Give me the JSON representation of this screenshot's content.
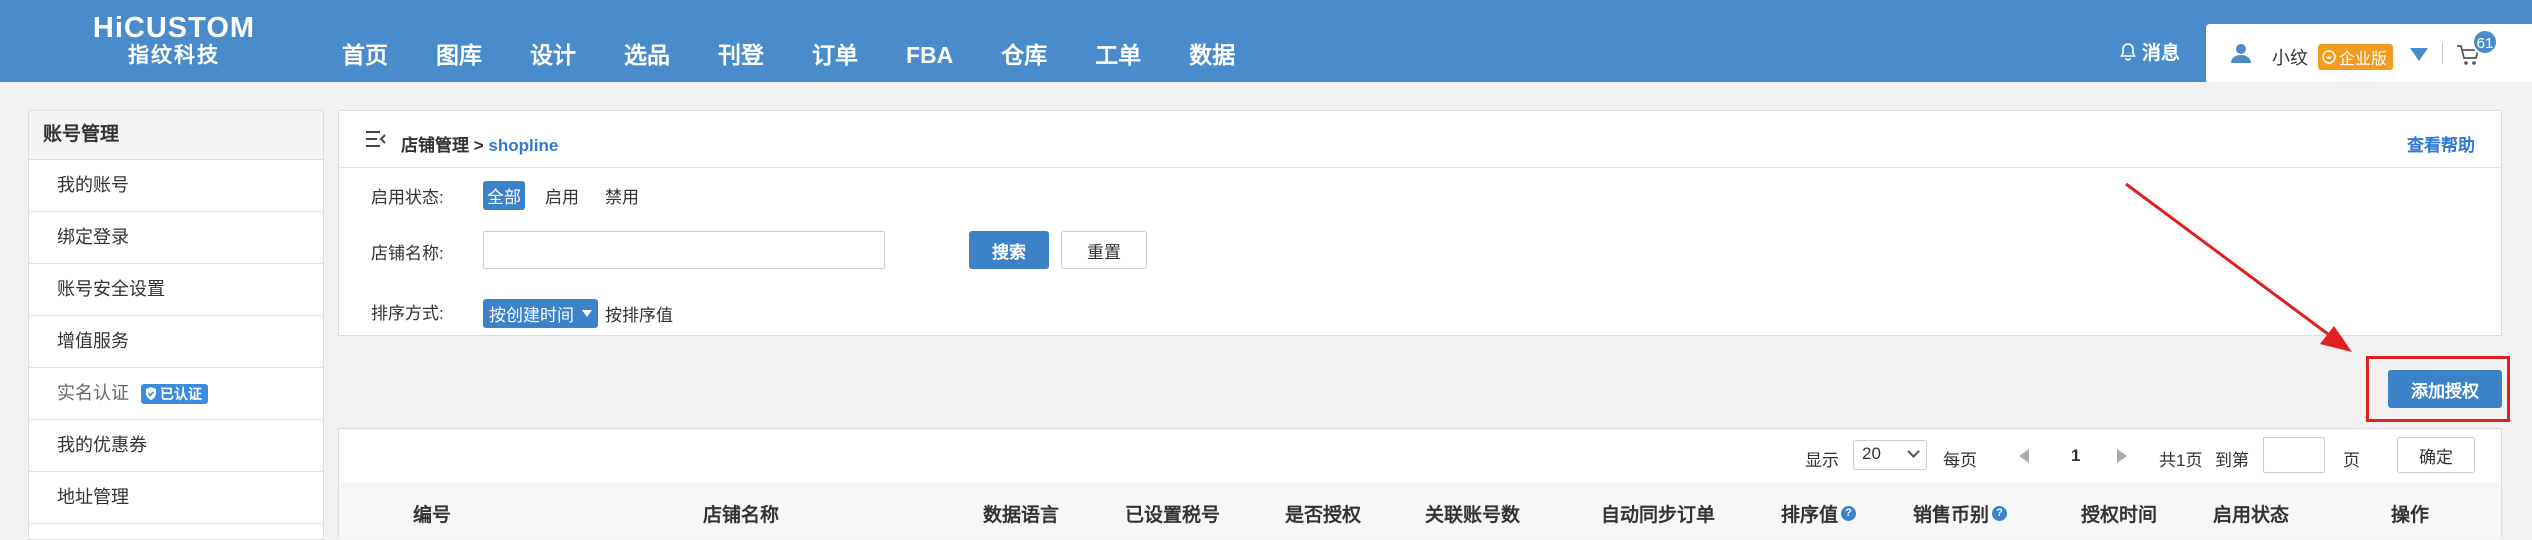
{
  "brand": {
    "line1": "HiCUSTOM",
    "line2": "指纹科技"
  },
  "nav": [
    "首页",
    "图库",
    "设计",
    "选品",
    "刊登",
    "订单",
    "FBA",
    "仓库",
    "工单",
    "数据"
  ],
  "header": {
    "messages": "消息",
    "username": "小纹",
    "edition": "企业版",
    "cart_count": "61"
  },
  "sidebar": {
    "title": "账号管理",
    "items": [
      "我的账号",
      "绑定登录",
      "账号安全设置",
      "增值服务",
      "实名认证",
      "我的优惠券",
      "地址管理"
    ],
    "verified_badge": "已认证"
  },
  "breadcrumb": {
    "parent": "店铺管理",
    "sep": ">",
    "current": "shopline"
  },
  "help_link": "查看帮助",
  "filters": {
    "status_label": "启用状态:",
    "status_options": [
      "全部",
      "启用",
      "禁用"
    ],
    "name_label": "店铺名称:",
    "name_value": "",
    "search_btn": "搜索",
    "reset_btn": "重置",
    "sort_label": "排序方式:",
    "sort_selected": "按创建时间",
    "sort_alt": "按排序值"
  },
  "add_button": "添加授权",
  "pager": {
    "show_label": "显示",
    "page_size": "20",
    "per_page_label": "每页",
    "current_page": "1",
    "total_pages": "共1页",
    "goto_label": "到第",
    "page_unit": "页",
    "confirm_btn": "确定"
  },
  "table": {
    "headers": [
      "编号",
      "店铺名称",
      "数据语言",
      "已设置税号",
      "是否授权",
      "关联账号数",
      "自动同步订单",
      "排序值",
      "销售币别",
      "授权时间",
      "启用状态",
      "操作"
    ]
  },
  "colors": {
    "primary": "#4a8ccb",
    "button": "#3b82c9",
    "link": "#2f7ad6",
    "annotation": "#e02020",
    "edition_badge": "#f39b1f"
  }
}
